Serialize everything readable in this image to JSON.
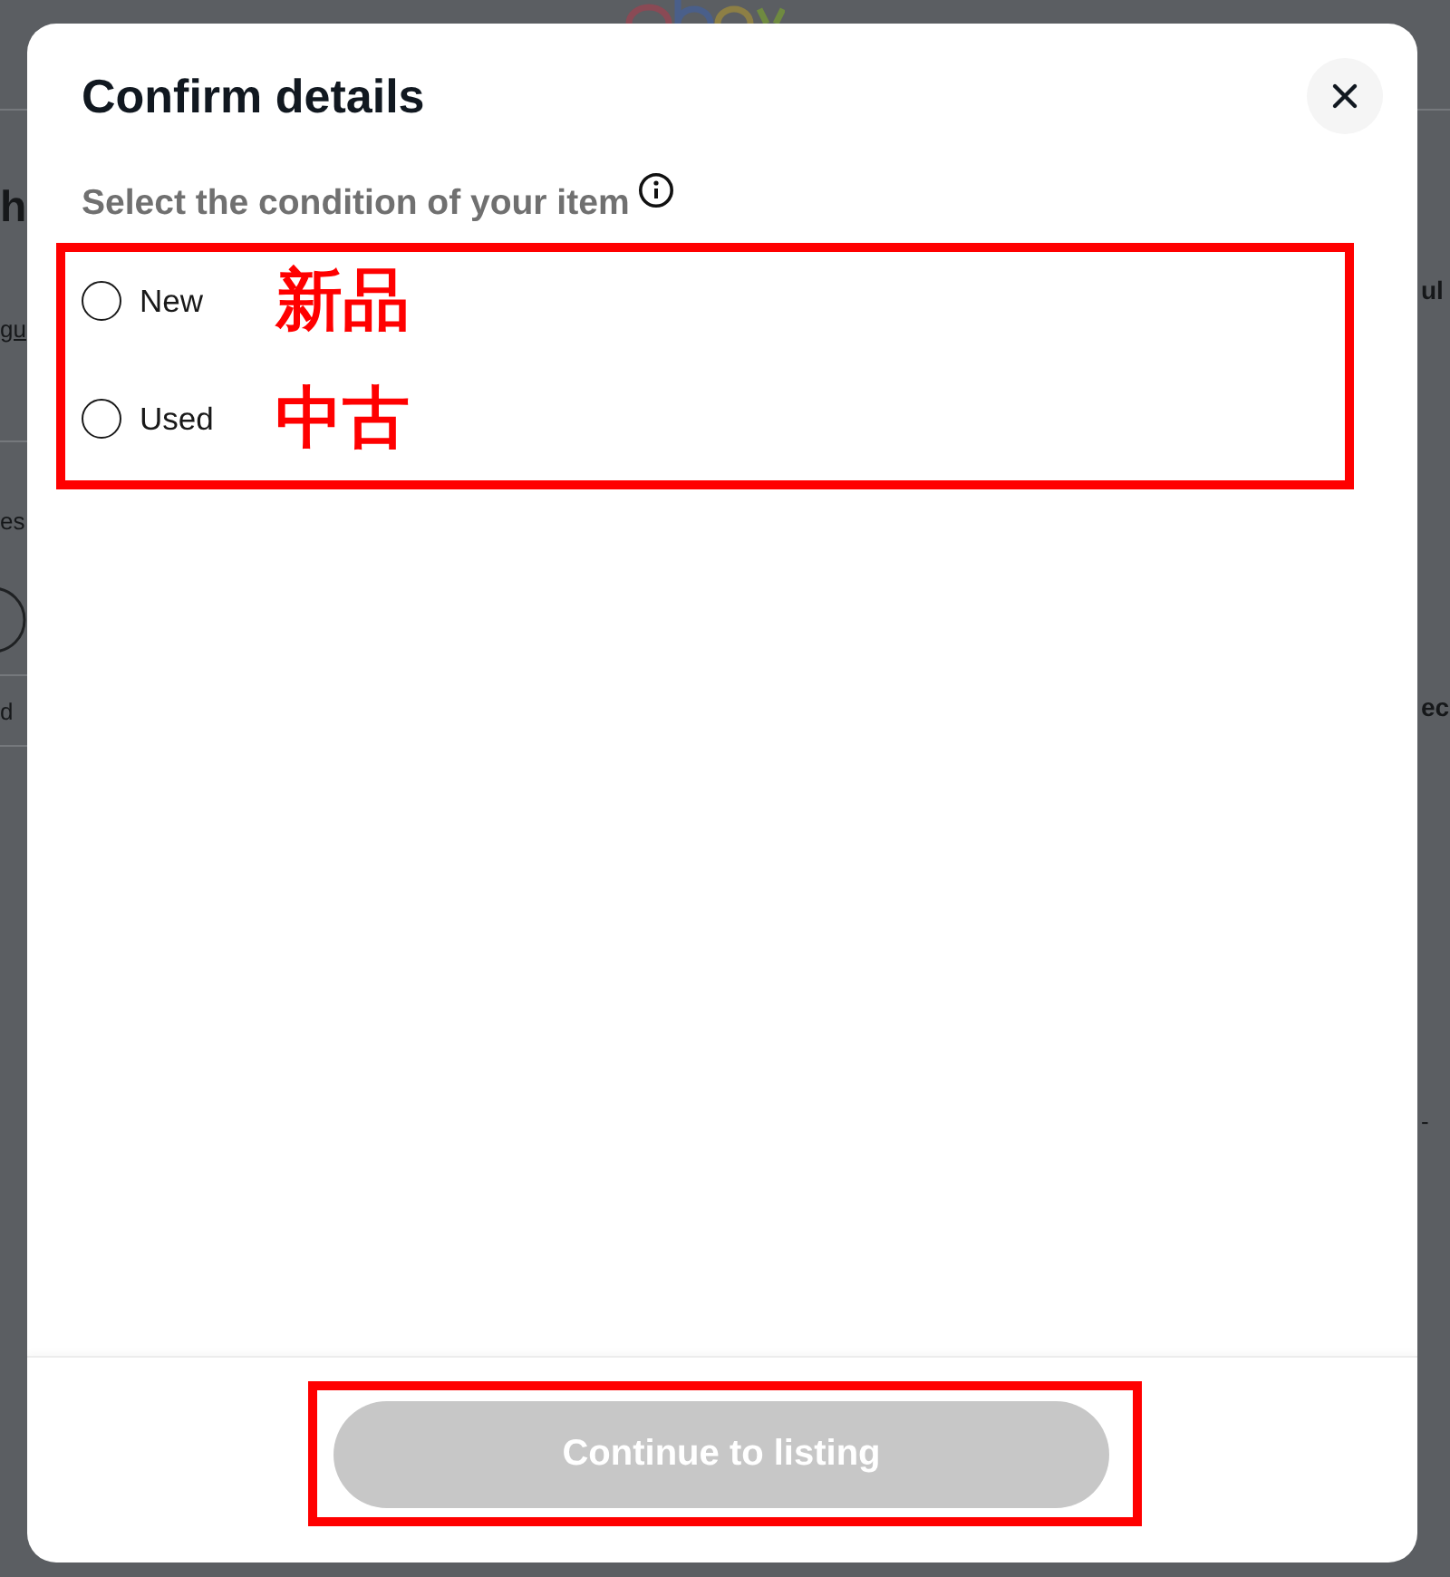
{
  "background": {
    "left_edge": [
      {
        "kind": "title",
        "text": "h"
      },
      {
        "kind": "link",
        "text": "gu"
      },
      {
        "kind": "text",
        "text": "es"
      },
      {
        "kind": "text",
        "text": "d"
      }
    ],
    "right_edge": [
      {
        "kind": "heading",
        "text": "ul"
      },
      {
        "kind": "heading",
        "text": "ec"
      },
      {
        "kind": "text",
        "text": "-"
      }
    ]
  },
  "dialog": {
    "title": "Confirm details",
    "prompt": "Select the condition of your item",
    "options": [
      {
        "label": "New",
        "note": "新品",
        "selected": false
      },
      {
        "label": "Used",
        "note": "中古",
        "selected": false
      }
    ],
    "button": {
      "label": "Continue to listing",
      "disabled": true
    }
  }
}
